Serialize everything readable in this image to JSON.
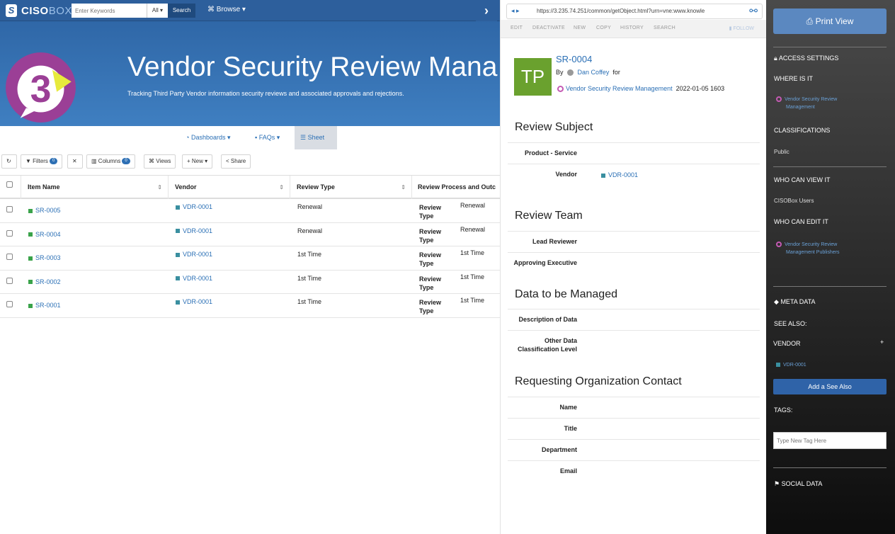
{
  "topbar": {
    "brand_a": "CISO",
    "brand_b": "BOX",
    "search_placeholder": "Enter Keywords",
    "search_scope": "All ▾",
    "search_button": "Search",
    "browse": "Browse ▾"
  },
  "banner": {
    "logo_text": "3",
    "title": "Vendor Security Review Mana",
    "subtitle": "Tracking Third Party Vendor information security reviews and associated approvals and rejections."
  },
  "tabs": [
    {
      "label": "Dashboards ▾"
    },
    {
      "label": "FAQs ▾"
    },
    {
      "label": "Sheet"
    }
  ],
  "toolbar": {
    "filters": "Filters",
    "filters_count": "0",
    "columns": "Columns",
    "columns_count": "0",
    "views": "Views",
    "new": "+ New ▾",
    "share": "Share"
  },
  "grid": {
    "columns": [
      "Item Name",
      "Vendor",
      "Review Type",
      "Review Process and Outc"
    ],
    "sub_label": "Review Type",
    "rows": [
      {
        "item": "SR-0005",
        "vendor": "VDR-0001",
        "type": "Renewal",
        "process": "Renewal"
      },
      {
        "item": "SR-0004",
        "vendor": "VDR-0001",
        "type": "Renewal",
        "process": "Renewal"
      },
      {
        "item": "SR-0003",
        "vendor": "VDR-0001",
        "type": "1st Time",
        "process": "1st Time"
      },
      {
        "item": "SR-0002",
        "vendor": "VDR-0001",
        "type": "1st Time",
        "process": "1st Time"
      },
      {
        "item": "SR-0001",
        "vendor": "VDR-0001",
        "type": "1st Time",
        "process": "1st Time"
      }
    ]
  },
  "detail": {
    "url": "https://3.235.74.251/common/getObject.html?urn=vne:www.knowle",
    "actions": [
      "EDIT",
      "DEACTIVATE",
      "NEW",
      "COPY",
      "HISTORY",
      "SEARCH"
    ],
    "follow": "FOLLOW",
    "avatar": "TP",
    "record_id": "SR-0004",
    "by_label": "By",
    "author": "Dan Coffey",
    "for_label": "for",
    "collection": "Vendor Security Review Management",
    "date": "2022-01-05 1603",
    "sections": {
      "review_subject": "Review Subject",
      "review_team": "Review Team",
      "data_managed": "Data to be Managed",
      "requesting": "Requesting Organization Contact"
    },
    "fields": {
      "product_service": "Product - Service",
      "vendor": "Vendor",
      "vendor_value": "VDR-0001",
      "lead_reviewer": "Lead Reviewer",
      "approving_exec": "Approving Executive",
      "description": "Description of Data",
      "other_data_1": "Other Data",
      "other_data_2": "Classification Level",
      "name": "Name",
      "title": "Title",
      "department": "Department",
      "email": "Email"
    }
  },
  "sidebar": {
    "print": "Print View",
    "access_settings": "ACCESS SETTINGS",
    "where_is_it": "WHERE IS IT",
    "where_link_1": "Vendor Security Review",
    "where_link_2": "Management",
    "classifications": "CLASSIFICATIONS",
    "classification_value": "Public",
    "who_view": "WHO CAN VIEW IT",
    "who_view_value": "CISOBox Users",
    "who_edit": "WHO CAN EDIT IT",
    "edit_link_1": "Vendor Security Review",
    "edit_link_2": "Management Publishers",
    "meta": "META DATA",
    "see_also": "SEE ALSO:",
    "vendor": "VENDOR",
    "vendor_plus": "+",
    "vendor_link": "VDR-0001",
    "add_see_also": "Add a See Also",
    "tags": "TAGS:",
    "tag_placeholder": "Type New Tag Here",
    "social": "SOCIAL DATA"
  },
  "colors": {
    "header_blue": "#2d5f9c",
    "link": "#2a6fb5",
    "avatar_green": "#6aa12e",
    "sidebar_dark": "#1a1a1a"
  }
}
